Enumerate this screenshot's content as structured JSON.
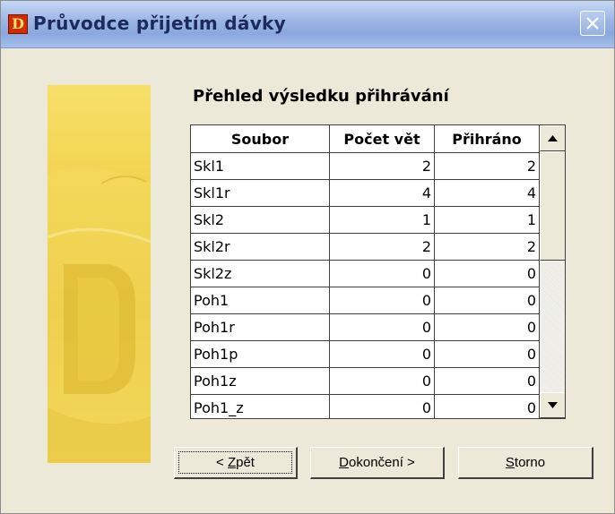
{
  "window": {
    "title": "Průvodce přijetím dávky",
    "app_icon_letter": "D"
  },
  "main": {
    "heading": "Přehled výsledku přihrávání",
    "columns": [
      "Soubor",
      "Počet vět",
      "Přihráno"
    ],
    "rows": [
      [
        "Skl1",
        "2",
        "2"
      ],
      [
        "Skl1r",
        "4",
        "4"
      ],
      [
        "Skl2",
        "1",
        "1"
      ],
      [
        "Skl2r",
        "2",
        "2"
      ],
      [
        "Skl2z",
        "0",
        "0"
      ],
      [
        "Poh1",
        "0",
        "0"
      ],
      [
        "Poh1r",
        "0",
        "0"
      ],
      [
        "Poh1p",
        "0",
        "0"
      ],
      [
        "Poh1z",
        "0",
        "0"
      ],
      [
        "Poh1_z",
        "0",
        "0"
      ]
    ]
  },
  "buttons": {
    "back": {
      "prefix": "< ",
      "mnemonic": "Z",
      "rest": "pět"
    },
    "finish": {
      "mnemonic": "D",
      "rest": "okončení >"
    },
    "cancel": {
      "mnemonic": "S",
      "rest": "torno"
    }
  },
  "colors": {
    "banner": "#f1d24a",
    "title_text": "#1d2a5c"
  }
}
